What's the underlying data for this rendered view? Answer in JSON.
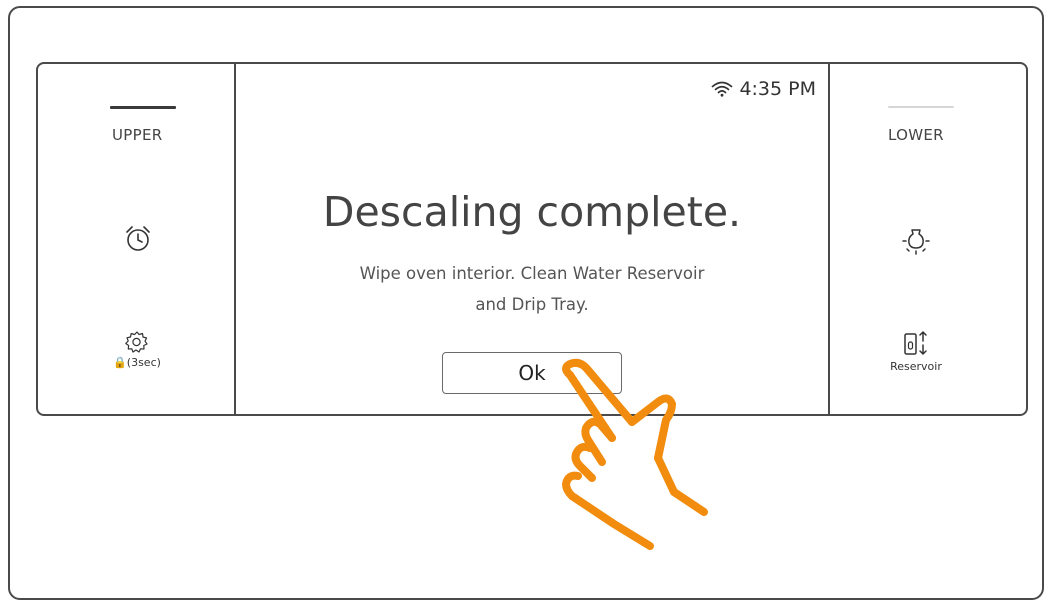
{
  "left_panel": {
    "cavity_label": "UPPER",
    "timer_icon": "alarm-clock-icon",
    "settings_icon": "gear-icon",
    "settings_caption": "🔒(3sec)"
  },
  "right_panel": {
    "cavity_label": "LOWER",
    "light_icon": "light-bulb-icon",
    "reservoir_icon": "reservoir-icon",
    "reservoir_caption": "Reservoir"
  },
  "display": {
    "status": {
      "wifi_icon": "wifi-icon",
      "time": "4:35 PM"
    },
    "title": "Descaling complete.",
    "message_line1": "Wipe oven interior. Clean Water Reservoir",
    "message_line2": "and Drip Tray.",
    "ok_label": "Ok"
  },
  "overlay": {
    "pointer_icon": "tapping-hand-icon"
  },
  "colors": {
    "frame": "#4a4a4a",
    "hand": "#f28c0f",
    "text": "#444444"
  }
}
